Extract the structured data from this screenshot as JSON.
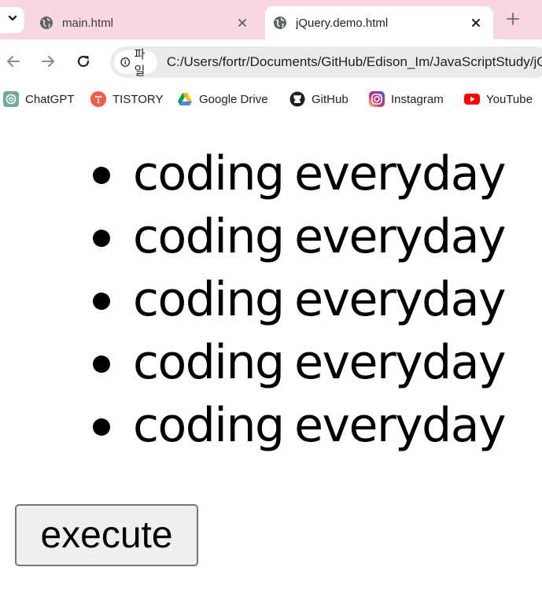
{
  "browser": {
    "tabs": [
      {
        "title": "main.html",
        "active": false
      },
      {
        "title": "jQuery.demo.html",
        "active": true
      }
    ],
    "address": {
      "chip_label": "파일",
      "url": "C:/Users/fortr/Documents/GitHub/Edison_Im/JavaScriptStudy/jQuery.demo.html"
    },
    "bookmarks": [
      {
        "label": "ChatGPT",
        "icon": "chatgpt-icon"
      },
      {
        "label": "TISTORY",
        "icon": "tistory-icon"
      },
      {
        "label": "Google Drive",
        "icon": "google-drive-icon"
      },
      {
        "label": "GitHub",
        "icon": "github-icon"
      },
      {
        "label": "Instagram",
        "icon": "instagram-icon"
      },
      {
        "label": "YouTube",
        "icon": "youtube-icon"
      }
    ],
    "colors": {
      "tabstrip": "#f6d7e2",
      "omnibox": "#ebebeb"
    }
  },
  "page": {
    "items": [
      "coding everyday",
      "coding everyday",
      "coding everyday",
      "coding everyday",
      "coding everyday"
    ],
    "button_label": "execute"
  }
}
